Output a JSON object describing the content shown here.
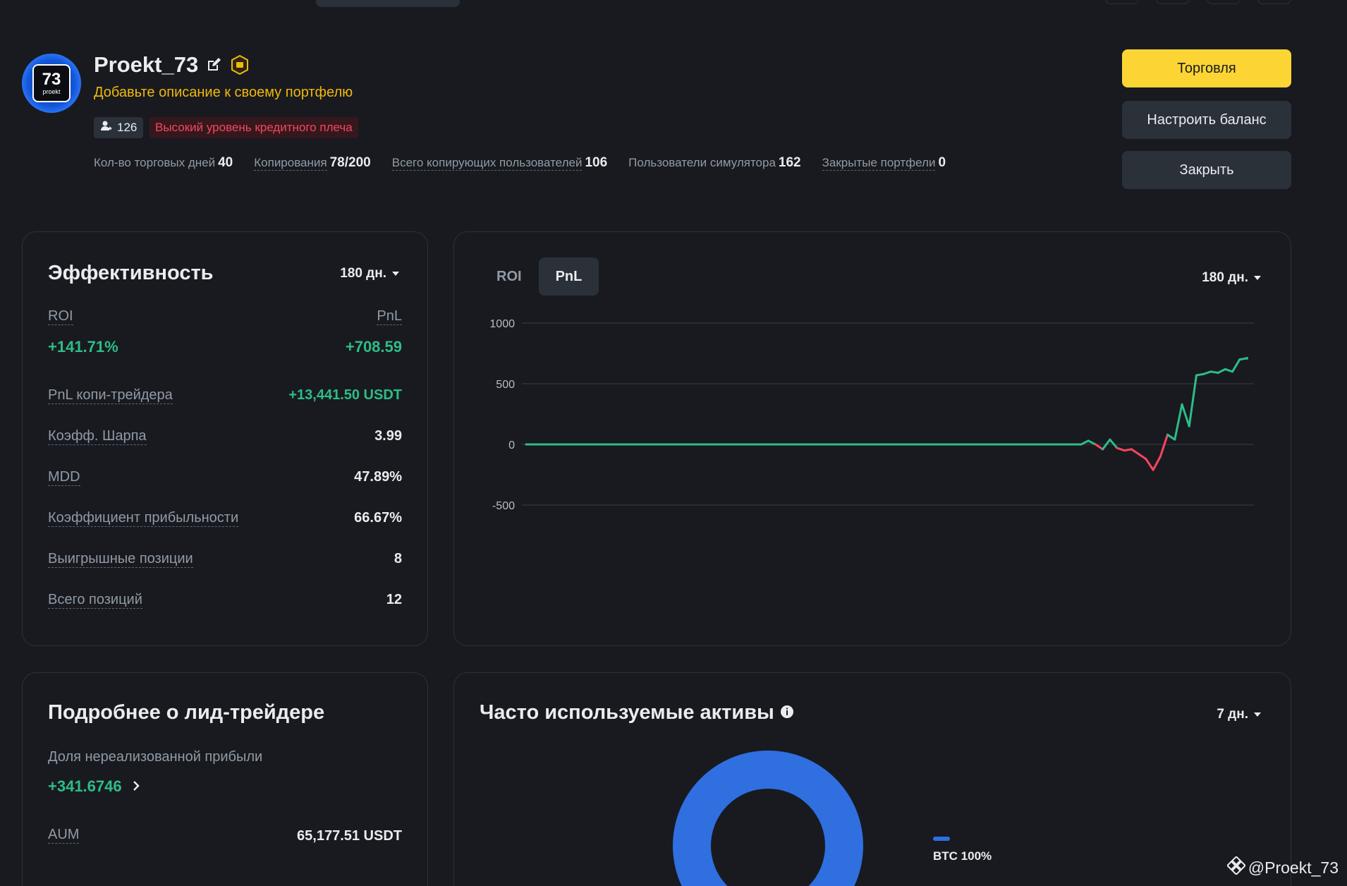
{
  "profile": {
    "avatar_number": "73",
    "avatar_sub": "proekt",
    "name": "Proekt_73",
    "description": "Добавьте описание к своему портфелю",
    "followers": "126",
    "leverage_tag": "Высокий уровень кредитного плеча"
  },
  "stats": [
    {
      "label": "Кол-во торговых дней",
      "value": "40"
    },
    {
      "label": "Копирования",
      "value": "78/200"
    },
    {
      "label": "Всего копирующих пользователей",
      "value": "106"
    },
    {
      "label": "Пользователи симулятора",
      "value": "162"
    },
    {
      "label": "Закрытые портфели",
      "value": "0"
    }
  ],
  "actions": {
    "trade": "Торговля",
    "adjust_balance": "Настроить баланс",
    "close": "Закрыть"
  },
  "performance": {
    "title": "Эффективность",
    "period": "180 дн.",
    "roi_label": "ROI",
    "pnl_label": "PnL",
    "roi_value": "+141.71%",
    "pnl_value": "+708.59",
    "rows": [
      {
        "label": "PnL копи-трейдера",
        "value": "+13,441.50 USDT",
        "positive": true
      },
      {
        "label": "Коэфф. Шарпа",
        "value": "3.99"
      },
      {
        "label": "MDD",
        "value": "47.89%"
      },
      {
        "label": "Коэффициент прибыльности",
        "value": "66.67%"
      },
      {
        "label": "Выигрышные позиции",
        "value": "8"
      },
      {
        "label": "Всего позиций",
        "value": "12"
      }
    ]
  },
  "pnl_chart": {
    "tabs": [
      "ROI",
      "PnL"
    ],
    "active_tab": "PnL",
    "period": "180 дн."
  },
  "chart_data": {
    "type": "line",
    "title": "",
    "xlabel": "",
    "ylabel": "",
    "ylim": [
      -500,
      1000
    ],
    "yticks": [
      1000,
      500,
      0,
      -500
    ],
    "grid": true,
    "x": [
      0,
      10,
      20,
      30,
      40,
      50,
      60,
      70,
      77,
      78,
      79,
      80,
      81,
      82,
      83,
      84,
      85,
      86,
      87,
      88,
      89,
      90,
      91,
      92,
      93,
      94,
      95,
      96,
      97,
      98,
      99,
      100
    ],
    "values": [
      0,
      0,
      0,
      0,
      0,
      0,
      0,
      0,
      0,
      30,
      0,
      -40,
      40,
      -30,
      -50,
      -40,
      -80,
      -120,
      -210,
      -100,
      80,
      40,
      330,
      150,
      570,
      580,
      600,
      590,
      620,
      600,
      700,
      710
    ],
    "positive_color": "#2ebd85",
    "negative_color": "#f6465d"
  },
  "lead_trader": {
    "title": "Подробнее о лид-трейдере",
    "unrealized_label": "Доля нереализованной прибыли",
    "unrealized_value": "+341.6746",
    "aum_label": "AUM",
    "aum_value": "65,177.51 USDT"
  },
  "assets": {
    "title": "Часто используемые активы",
    "period": "7 дн.",
    "legend": "BTC 100%",
    "color": "#2f6fe0"
  },
  "watermark": "@Proekt_73"
}
